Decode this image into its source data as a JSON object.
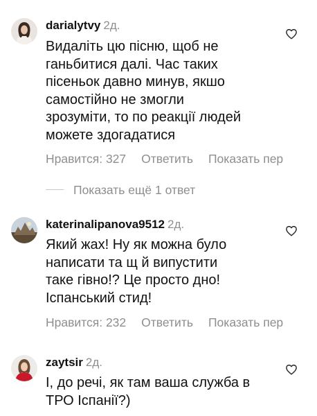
{
  "comments": [
    {
      "username": "darialytvy",
      "time": "2д.",
      "text_lines": [
        "Видаліть цю пісню, щоб не",
        "ганьбитися далі. Час таких",
        "пісеньок давно минув, якшо",
        "самостійно не змогли",
        "зрозуміти, то по реакції людей",
        "можете здогадатися"
      ],
      "likes": "Нравится: 327",
      "reply": "Ответить",
      "translate": "Показать пер"
    },
    {
      "username": "katerinalipanova9512",
      "time": "2д.",
      "text_lines": [
        "Який жах! Ну як можна було",
        "написати та щ й випустити",
        "таке гівно!? Це просто дно!",
        "Іспанський стид!"
      ],
      "likes": "Нравится: 232",
      "reply": "Ответить",
      "translate": "Показать пер"
    },
    {
      "username": "zaytsir",
      "time": "2д.",
      "text_lines": [
        "І, до речі, як там ваша служба в",
        "ТРО Іспанії?)"
      ]
    }
  ],
  "more_replies": "Показать ещё 1 ответ",
  "icons": {
    "like": "heart-outline-icon"
  },
  "colors": {
    "text": "#111111",
    "muted": "#8e8e8e",
    "background": "#ffffff"
  }
}
